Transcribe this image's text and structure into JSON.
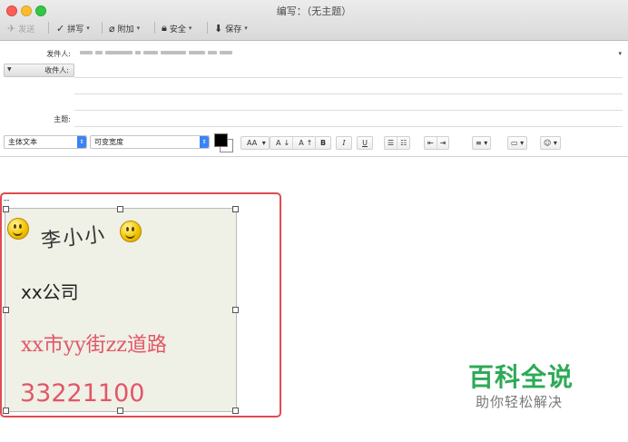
{
  "window": {
    "title": "编写：（无主题）"
  },
  "toolbar": {
    "send": "发送",
    "spelling": "拼写",
    "attach": "附加",
    "security": "安全",
    "save": "保存",
    "send_icon": "paper-plane-icon",
    "spelling_icon": "checkmark-icon",
    "attach_icon": "paperclip-icon",
    "security_icon": "lock-icon",
    "save_icon": "arrow-down-icon"
  },
  "headers": {
    "from_label": "发件人:",
    "to_label": "收件人:",
    "subject_label": "主题:",
    "subject_value": "",
    "to_value": ""
  },
  "format_bar": {
    "font_family": "主体文本",
    "font_size": "可变宽度",
    "text_color": "#000000",
    "background_color": "#ffffff",
    "font_size_menu": "AA",
    "smaller": "A",
    "larger": "A",
    "bold": "B",
    "italic": "I",
    "underline": "U"
  },
  "body": {
    "signature_separator": "--",
    "signature": {
      "name": "李小小",
      "company": "xx公司",
      "address": "xx市yy街zz道路",
      "phone": "33221100"
    }
  },
  "watermark": {
    "main": "百科全说",
    "sub": "助你轻松解决"
  },
  "colors": {
    "highlight_outline": "#e04a4f",
    "signature_red": "#e25668",
    "watermark_green": "#2eaa57"
  }
}
